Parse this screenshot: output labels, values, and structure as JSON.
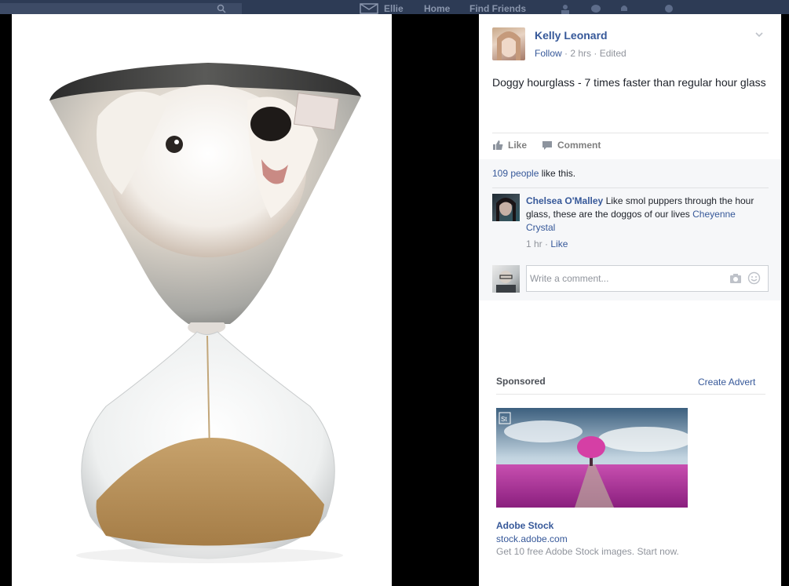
{
  "topbar": {
    "nav_ellie": "Ellie",
    "nav_home": "Home",
    "nav_find": "Find Friends"
  },
  "post": {
    "author": "Kelly Leonard",
    "follow": "Follow",
    "time_meta": "· 2 hrs · Edited",
    "text": "Doggy hourglass - 7 times faster than regular hour glass",
    "like_label": "Like",
    "comment_label": "Comment"
  },
  "likes": {
    "count": "109 people",
    "suffix": " like this."
  },
  "comments": [
    {
      "name": "Chelsea O'Malley",
      "text": " Like smol puppers through the hour glass, these are the doggos of our lives ",
      "tag": "Cheyenne Crystal",
      "time": "1 hr",
      "sep": " · ",
      "like": "Like"
    }
  ],
  "write_comment": {
    "placeholder": "Write a comment..."
  },
  "ad": {
    "sponsored_label": "Sponsored",
    "create_advert": "Create Advert",
    "brand_badge": "St",
    "title": "Adobe Stock",
    "url": "stock.adobe.com",
    "description": "Get 10 free Adobe Stock images. Start now."
  },
  "colors": {
    "link_blue": "#365899",
    "text": "#1d2129",
    "muted": "#90949c",
    "topbar": "#2d3b55"
  }
}
